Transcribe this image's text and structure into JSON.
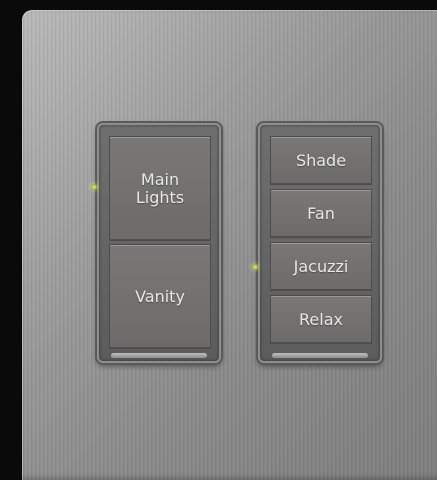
{
  "keypad_left": {
    "buttons": [
      {
        "label": "Main\nLights"
      },
      {
        "label": "Vanity"
      }
    ]
  },
  "keypad_right": {
    "buttons": [
      {
        "label": "Shade"
      },
      {
        "label": "Fan"
      },
      {
        "label": "Jacuzzi"
      },
      {
        "label": "Relax"
      }
    ]
  },
  "colors": {
    "plate": "#9a9a9a",
    "button": "#726f6f",
    "label": "#e8e8e8",
    "led": "#e6f07a"
  }
}
